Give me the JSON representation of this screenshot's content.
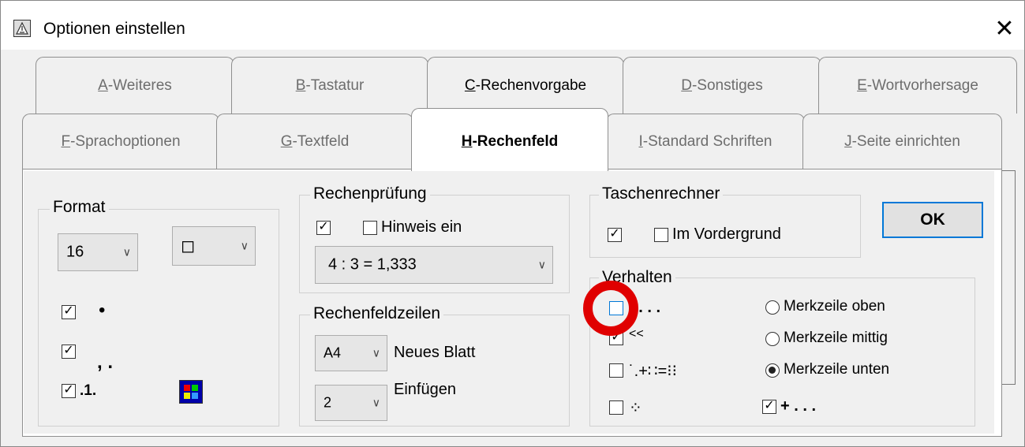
{
  "window": {
    "title": "Optionen einstellen",
    "close_glyph": "✕"
  },
  "tabs_row1": [
    {
      "key": "A",
      "rest": "-Weiteres"
    },
    {
      "key": "B",
      "rest": "-Tastatur"
    },
    {
      "key": "C",
      "rest": "-Rechenvorgabe"
    },
    {
      "key": "D",
      "rest": "-Sonstiges"
    },
    {
      "key": "E",
      "rest": "-Wortvorhersage"
    }
  ],
  "tabs_row2": [
    {
      "key": "F",
      "rest": "-Sprachoptionen"
    },
    {
      "key": "G",
      "rest": "-Textfeld"
    },
    {
      "key": "H",
      "rest": "-Rechenfeld"
    },
    {
      "key": "I",
      "rest": "-Standard Schriften"
    },
    {
      "key": "J",
      "rest": "-Seite einrichten"
    }
  ],
  "selected_tab": "H-Rechenfeld",
  "format": {
    "title": "Format",
    "size_value": "16",
    "shape_glyph": "◻",
    "dot_label": "•",
    "comma_label": ", .",
    "one_label": ".1."
  },
  "rechenpruefung": {
    "title": "Rechenprüfung",
    "hint_label": "Hinweis ein",
    "example_value": "4 : 3 = 1,333"
  },
  "rechenfeldzeilen": {
    "title": "Rechenfeldzeilen",
    "paper_value": "A4",
    "new_sheet_label": "Neues Blatt",
    "insert_value": "2",
    "insert_label": "Einfügen"
  },
  "taschenrechner": {
    "title": "Taschenrechner",
    "foreground_label": "Im Vordergrund"
  },
  "ok_label": "OK",
  "verhalten": {
    "title": "Verhalten",
    "opt1": ": . . .",
    "opt2": "<<",
    "opt3": "˙.+∷=⁝⁝",
    "opt4": "⁘",
    "radio_top": "Merkzeile oben",
    "radio_mid": "Merkzeile mittig",
    "radio_bottom": "Merkzeile unten",
    "plus_label": "+ . . ."
  },
  "colors": {
    "accent": "#0078d7",
    "highlight": "#e00000"
  }
}
